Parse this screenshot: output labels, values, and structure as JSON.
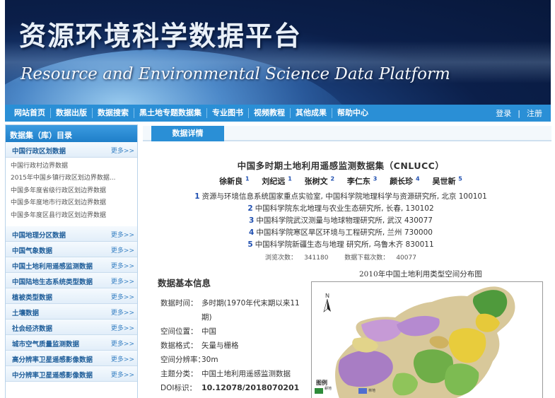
{
  "banner": {
    "title_cn": "资源环境科学数据平台",
    "title_en": "Resource and Environmental Science Data Platform"
  },
  "nav": {
    "items": [
      "网站首页",
      "数据出版",
      "数据搜索",
      "黑土地专题数据集",
      "专业图书",
      "视频教程",
      "其他成果",
      "帮助中心"
    ],
    "login": "登录",
    "separator": "|",
    "register": "注册"
  },
  "sidebar": {
    "title": "数据集（库）目录",
    "more_label": "更多>>",
    "first_category": "中国行政区划数据",
    "first_items": [
      "中国行政村边界数据",
      "2015年中国乡镇行政区划边界数据...",
      "中国多年度省级行政区划边界数据",
      "中国多年度地市行政区划边界数据",
      "中国多年度区县行政区划边界数据"
    ],
    "categories": [
      "中国地理分区数据",
      "中国气象数据",
      "中国土地利用遥感监测数据",
      "中国陆地生态系统类型数据",
      "植被类型数据",
      "土壤数据",
      "社会经济数据",
      "城市空气质量监测数据",
      "高分辨率卫星遥感影像数据",
      "中分辨率卫星遥感影像数据"
    ]
  },
  "main": {
    "tab": "数据详情",
    "dataset_title": "中国多时期土地利用遥感监测数据集（CNLUCC）",
    "authors": [
      {
        "name": "徐新良",
        "sup": "1"
      },
      {
        "name": "刘纪远",
        "sup": "1"
      },
      {
        "name": "张树文",
        "sup": "2"
      },
      {
        "name": "李仁东",
        "sup": "3"
      },
      {
        "name": "颜长珍",
        "sup": "4"
      },
      {
        "name": "吴世新",
        "sup": "5"
      }
    ],
    "affiliations": [
      {
        "num": "1",
        "text": "资源与环境信息系统国家重点实验室, 中国科学院地理科学与资源研究所, 北京 100101"
      },
      {
        "num": "2",
        "text": "中国科学院东北地理与农业生态研究所, 长春, 130102"
      },
      {
        "num": "3",
        "text": "中国科学院武汉测量与地球物理研究所, 武汉 430077"
      },
      {
        "num": "4",
        "text": "中国科学院寒区旱区环境与工程研究所, 兰州 730000"
      },
      {
        "num": "5",
        "text": "中国科学院新疆生态与地理 研究所, 乌鲁木齐 830011"
      }
    ],
    "views_label": "浏览次数：",
    "views": "341180",
    "downloads_label": "数据下载次数：",
    "downloads": "40077",
    "basic_info_title": "数据基本信息",
    "info_rows": [
      {
        "key": "数据时间：",
        "value": "多时期(1970年代末期以来11期)"
      },
      {
        "key": "空间位置：",
        "value": "中国"
      },
      {
        "key": "数据格式：",
        "value": "矢量与栅格"
      },
      {
        "key": "空间分辨率：",
        "value": "30m"
      },
      {
        "key": "主题分类：",
        "value": "中国土地利用遥感监测数据"
      },
      {
        "key": "DOI标识：",
        "value": "10.12078/2018070201"
      }
    ],
    "map_title": "2010年中国土地利用类型空间分布图",
    "map_north": "N",
    "map_legend_title": "图例",
    "map_legend_items": [
      {
        "label": "耕地",
        "color": "#2e8b3a"
      },
      {
        "label": "林地",
        "color": "#4e6ed0"
      }
    ]
  }
}
